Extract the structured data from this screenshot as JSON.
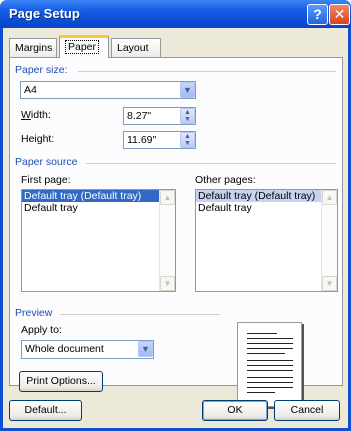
{
  "window": {
    "title": "Page Setup",
    "help_label": "?",
    "close_label": "✕"
  },
  "tabs": [
    {
      "label": "Margins"
    },
    {
      "label": "Paper"
    },
    {
      "label": "Layout"
    }
  ],
  "paper_size": {
    "group_label": "Paper size:",
    "selected": "A4",
    "width_label": "Width:",
    "width_value": "8.27\"",
    "height_label": "Height:",
    "height_value": "11.69\""
  },
  "paper_source": {
    "group_label": "Paper source",
    "first_page_label": "First page:",
    "first_page_items": [
      "Default tray (Default tray)",
      "Default tray"
    ],
    "other_pages_label": "Other pages:",
    "other_pages_items": [
      "Default tray (Default tray)",
      "Default tray"
    ]
  },
  "preview": {
    "group_label": "Preview",
    "apply_to_label": "Apply to:",
    "apply_to_value": "Whole document"
  },
  "buttons": {
    "print_options": "Print Options...",
    "default": "Default...",
    "ok": "OK",
    "cancel": "Cancel"
  },
  "icons": {
    "dropdown": "chevron-down-icon",
    "spin_up": "spin-up-icon",
    "spin_down": "spin-down-icon",
    "scroll_up": "scroll-up-icon",
    "scroll_down": "scroll-down-icon"
  },
  "colors": {
    "titlebar": "#0a4bd3",
    "group_label": "#1d4fb5",
    "selection": "#316ac5",
    "tab_accent": "#ffc73c"
  }
}
